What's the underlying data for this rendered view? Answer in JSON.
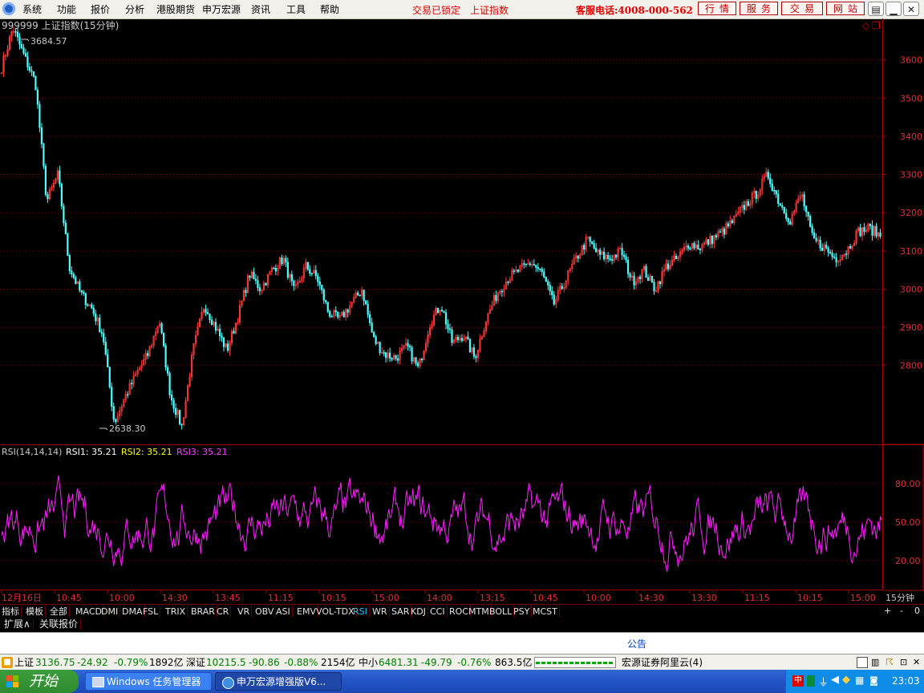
{
  "menu": [
    "系统",
    "功能",
    "报价",
    "分析",
    "港股期货",
    "申万宏源",
    "资讯",
    "工具",
    "帮助"
  ],
  "status_locked": "交易已锁定",
  "current_index": "上证指数",
  "hotline": "客服电话:4008-000-562",
  "top_buttons": [
    "行情",
    "服务",
    "交易",
    "网站"
  ],
  "chart": {
    "title": "999999 上证指数(15分钟)",
    "high_label": "3684.57",
    "low_label": "2638.30",
    "price_ticks": [
      "3600",
      "3500",
      "3400",
      "3300",
      "3200",
      "3100",
      "3000",
      "2900",
      "2800"
    ],
    "rsi_header": "RSI(14,14,14)",
    "rsi1": "RSI1: 35.21",
    "rsi2": "RSI2: 35.21",
    "rsi3": "RSI3: 35.21",
    "rsi_ticks": [
      "80.00",
      "50.00",
      "20.00"
    ],
    "time_labels": [
      "12月16日",
      "10:45",
      "10:00",
      "14:30",
      "13:45",
      "11:15",
      "10:15",
      "15:00",
      "14:00",
      "13:15",
      "10:45",
      "10:00",
      "14:30",
      "13:30",
      "11:15",
      "10:15",
      "15:00"
    ],
    "period": "15分钟"
  },
  "chart_data": {
    "type": "candlestick",
    "symbol": "999999",
    "name": "上证指数",
    "period": "15分钟",
    "y_range": [
      2600,
      3700
    ],
    "high": 3684.57,
    "low": 2638.3,
    "close_series": [
      3580,
      3684,
      3610,
      3540,
      3230,
      3300,
      3060,
      2990,
      2950,
      2880,
      2650,
      2720,
      2780,
      2830,
      2920,
      2720,
      2640,
      2840,
      2960,
      2900,
      2840,
      2930,
      3040,
      3000,
      3050,
      3080,
      2990,
      3060,
      3030,
      2940,
      2920,
      2960,
      3000,
      2870,
      2830,
      2820,
      2850,
      2790,
      2910,
      2960,
      2860,
      2880,
      2820,
      2920,
      2990,
      3030,
      3050,
      3070,
      3040,
      2960,
      3020,
      3080,
      3130,
      3090,
      3080,
      3100,
      3020,
      3050,
      3000,
      3060,
      3080,
      3120,
      3110,
      3130,
      3150,
      3180,
      3220,
      3250,
      3300,
      3230,
      3180,
      3250,
      3130,
      3110,
      3080,
      3100,
      3150,
      3160,
      3140
    ],
    "indicator": {
      "name": "RSI",
      "params": [
        14,
        14,
        14
      ],
      "RSI1": 35.21,
      "RSI2": 35.21,
      "RSI3": 35.21,
      "y_ticks": [
        80,
        50,
        20
      ]
    }
  },
  "indicator_tabs": [
    "指标",
    "模板",
    "全部",
    "MACD",
    "DMI",
    "DMA",
    "FSL",
    "TRIX",
    "BRAR",
    "CR",
    "VR",
    "OBV",
    "ASI",
    "EMV",
    "VOL-TDX",
    "RSI",
    "WR",
    "SAR",
    "KDJ",
    "CCI",
    "ROC",
    "MTM",
    "BOLL",
    "PSY",
    "MCST"
  ],
  "active_tab": "RSI",
  "second_tabs": [
    "扩展∧",
    "关联报价"
  ],
  "scroll_ctrl": [
    "+",
    "-",
    "0"
  ],
  "notice": "公告",
  "status": {
    "sh_name": "上证",
    "sh_val": "3136.75",
    "sh_chg": "-24.92",
    "sh_pct": "-0.79%",
    "sh_amt": "1892亿",
    "sz_name": "深证",
    "sz_val": "10215.5",
    "sz_chg": "-90.86",
    "sz_pct": "-0.88%",
    "sz_amt": "2154亿",
    "zx_name": "中小",
    "zx_val": "6481.31",
    "zx_chg": "-49.79",
    "zx_pct": "-0.76%",
    "zx_amt": "863.5亿",
    "server": "宏源证券阿里云(4)"
  },
  "taskbar": {
    "start": "开始",
    "tasks": [
      "Windows 任务管理器",
      "申万宏源增强版V6..."
    ],
    "clock": "23:03"
  }
}
